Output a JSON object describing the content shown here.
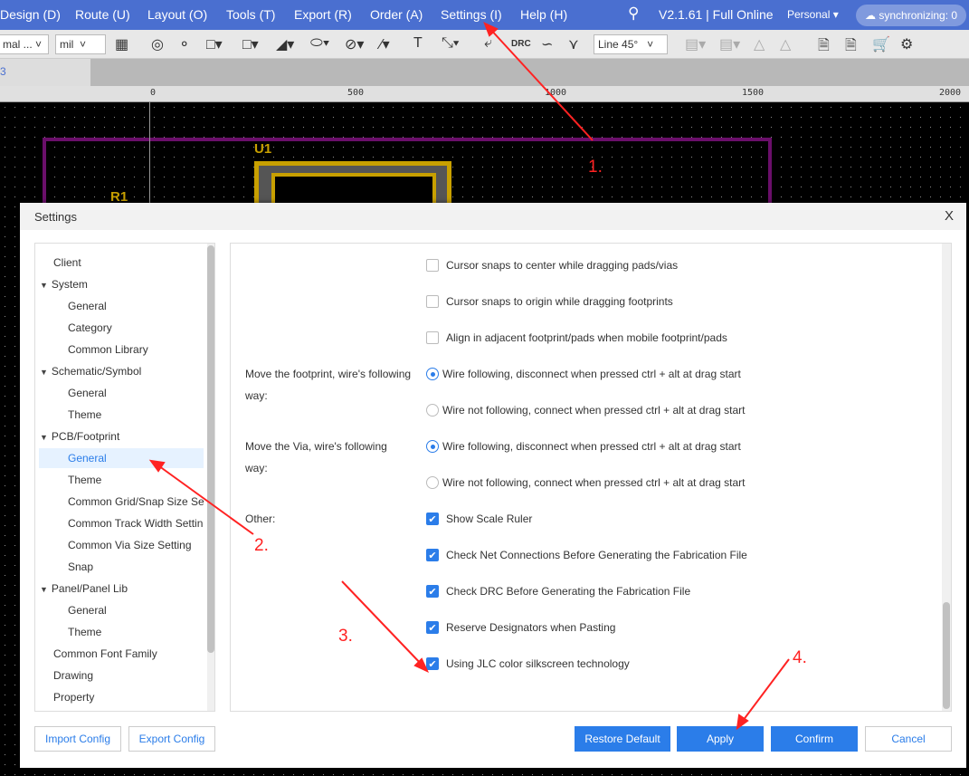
{
  "menubar": {
    "items": [
      "Design (D)",
      "Route (U)",
      "Layout (O)",
      "Tools (T)",
      "Export (R)",
      "Order (A)",
      "Settings (I)",
      "Help (H)"
    ],
    "version": "V2.1.61 | Full Online",
    "account": "Personal",
    "sync": "synchronizing: 0"
  },
  "toolbar": {
    "select1": "mal ...",
    "select2": "mil",
    "routing_mode": "Line 45°",
    "drc": "DRC"
  },
  "tab": {
    "label": "3"
  },
  "ruler": {
    "labels": [
      "0",
      "500",
      "1000",
      "1500",
      "2000"
    ]
  },
  "canvas": {
    "labels": [
      "U1",
      "R1"
    ],
    "colors": {
      "board_outline": "#6a0f6a",
      "silkscreen": "#c8a000"
    }
  },
  "dialog": {
    "title": "Settings",
    "close": "X",
    "tree": [
      {
        "label": "Client",
        "level": 0
      },
      {
        "label": "System",
        "level": 0,
        "expanded": true
      },
      {
        "label": "General",
        "level": 1
      },
      {
        "label": "Category",
        "level": 1
      },
      {
        "label": "Common Library",
        "level": 1
      },
      {
        "label": "Schematic/Symbol",
        "level": 0,
        "expanded": true
      },
      {
        "label": "General",
        "level": 1
      },
      {
        "label": "Theme",
        "level": 1
      },
      {
        "label": "PCB/Footprint",
        "level": 0,
        "expanded": true
      },
      {
        "label": "General",
        "level": 1,
        "active": true
      },
      {
        "label": "Theme",
        "level": 1
      },
      {
        "label": "Common Grid/Snap Size Se",
        "level": 1
      },
      {
        "label": "Common Track Width Settin",
        "level": 1
      },
      {
        "label": "Common Via Size Setting",
        "level": 1
      },
      {
        "label": "Snap",
        "level": 1
      },
      {
        "label": "Panel/Panel Lib",
        "level": 0,
        "expanded": true
      },
      {
        "label": "General",
        "level": 1
      },
      {
        "label": "Theme",
        "level": 1
      },
      {
        "label": "Common Font Family",
        "level": 0
      },
      {
        "label": "Drawing",
        "level": 0
      },
      {
        "label": "Property",
        "level": 0
      }
    ],
    "options": [
      {
        "type": "checkbox",
        "label": "Cursor snaps to center while dragging pads/vias",
        "checked": false
      },
      {
        "type": "checkbox",
        "label": "Cursor snaps to origin while dragging footprints",
        "checked": false
      },
      {
        "type": "checkbox",
        "label": "Align in adjacent footprint/pads when mobile footprint/pads",
        "checked": false
      },
      {
        "type": "radio",
        "label": "Wire following, disconnect when pressed ctrl + alt at drag start",
        "checked": true
      },
      {
        "type": "radio",
        "label": "Wire not following, connect when pressed ctrl + alt at drag start",
        "checked": false
      },
      {
        "type": "radio",
        "label": "Wire following, disconnect when pressed ctrl + alt at drag start",
        "checked": true
      },
      {
        "type": "radio",
        "label": "Wire not following, connect when pressed ctrl + alt at drag start",
        "checked": false
      },
      {
        "type": "checkbox",
        "label": "Show Scale Ruler",
        "checked": true
      },
      {
        "type": "checkbox",
        "label": "Check Net Connections Before Generating the Fabrication File",
        "checked": true
      },
      {
        "type": "checkbox",
        "label": "Check DRC Before Generating the Fabrication File",
        "checked": true
      },
      {
        "type": "checkbox",
        "label": "Reserve Designators when Pasting",
        "checked": true
      },
      {
        "type": "checkbox",
        "label": "Using JLC color silkscreen technology",
        "checked": true
      }
    ],
    "group_labels": {
      "footprint": "Move the footprint, wire's following way:",
      "via": "Move the Via, wire's following way:",
      "other": "Other:"
    },
    "buttons": {
      "import": "Import Config",
      "export": "Export Config",
      "restore": "Restore Default",
      "apply": "Apply",
      "confirm": "Confirm",
      "cancel": "Cancel"
    }
  },
  "annotations": [
    "1.",
    "2.",
    "3.",
    "4."
  ],
  "colors": {
    "accent": "#2b7de9",
    "menubar": "#4a6fd0",
    "annotation": "#ff2222"
  }
}
